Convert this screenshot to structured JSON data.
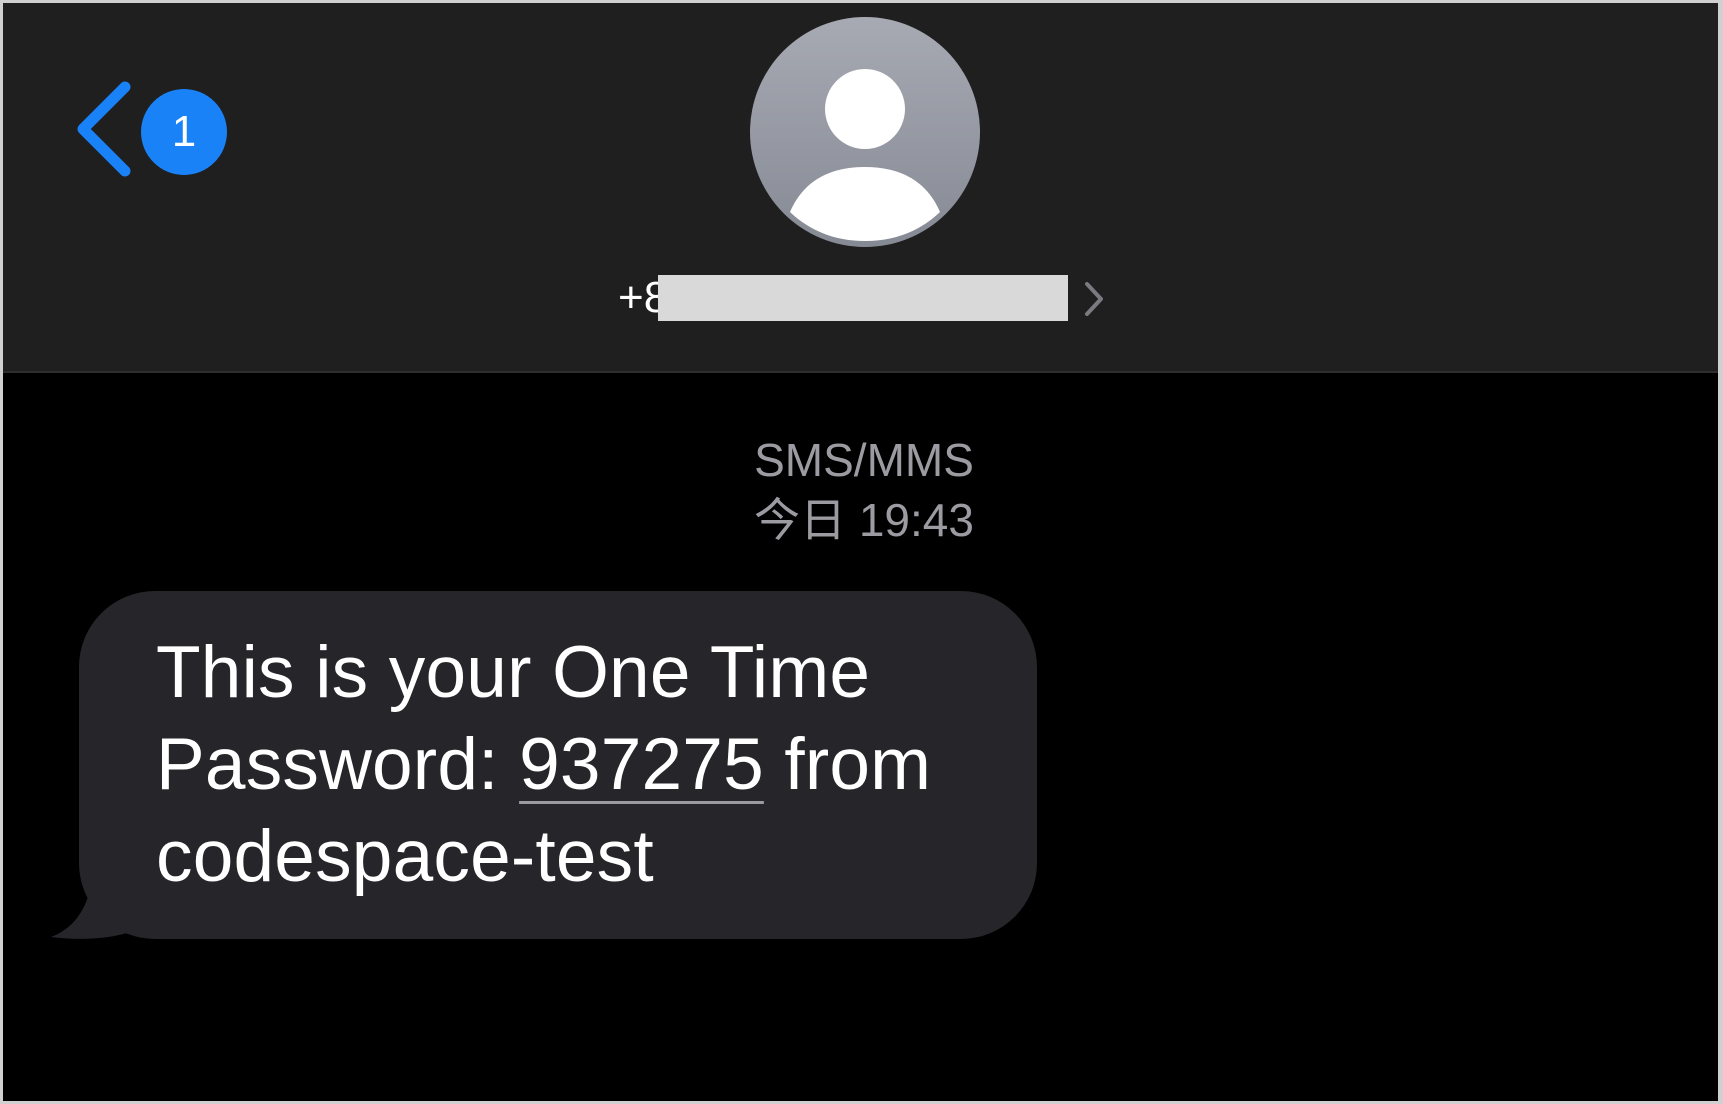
{
  "header": {
    "back_badge_count": "1",
    "contact_prefix": "+8",
    "avatar": "person-silhouette-icon",
    "back_icon": "chevron-left-icon",
    "contact_icon": "chevron-right-icon"
  },
  "conversation": {
    "service_label": "SMS/MMS",
    "timestamp": "今日 19:43",
    "message": {
      "before_code": "This is your One Time Password: ",
      "code": "937275",
      "after_code": " from codespace-test"
    }
  },
  "colors": {
    "header_bg": "#1f1f1f",
    "body_bg": "#000000",
    "accent": "#1a82f7",
    "bubble_bg": "#26262a",
    "meta_text": "#9b9ba1"
  }
}
